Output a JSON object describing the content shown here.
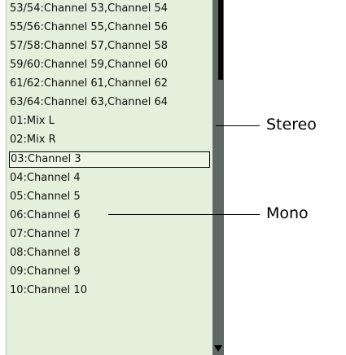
{
  "list": {
    "items": [
      "53/54:Channel 53,Channel 54",
      "55/56:Channel 55,Channel 56",
      "57/58:Channel 57,Channel 58",
      "59/60:Channel 59,Channel 60",
      "61/62:Channel 61,Channel 62",
      "63/64:Channel 63,Channel 64",
      "01:Mix L",
      "02:Mix R",
      "03:Channel 3",
      "04:Channel 4",
      "05:Channel 5",
      "06:Channel 6",
      "07:Channel 7",
      "08:Channel 8",
      "09:Channel 9",
      "10:Channel 10"
    ],
    "selected": "03:Channel 3"
  },
  "scrollbar": {
    "down_arrow_icon": "triangle-down-icon"
  },
  "callouts": {
    "stereo": "Stereo",
    "mono": "Mono"
  }
}
